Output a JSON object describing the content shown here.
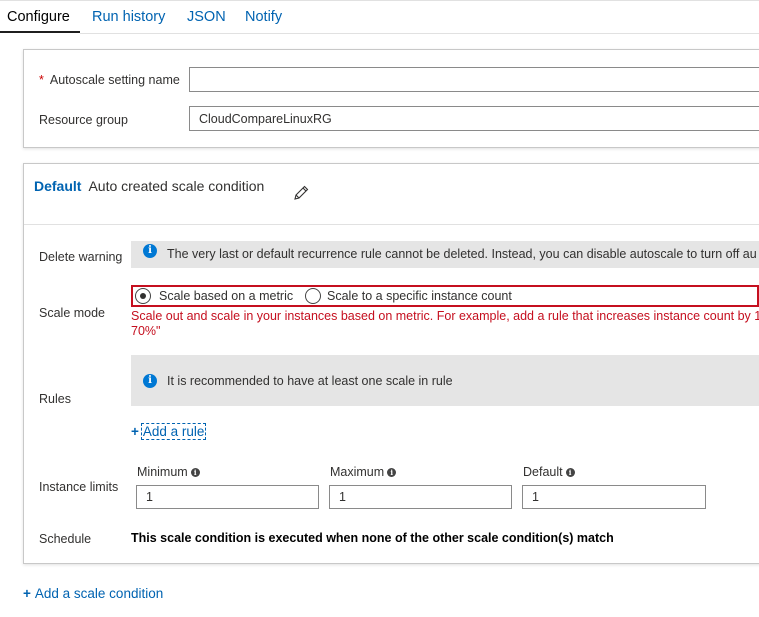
{
  "tabs": [
    {
      "label": "Configure",
      "active": true
    },
    {
      "label": "Run history",
      "active": false
    },
    {
      "label": "JSON",
      "active": false
    },
    {
      "label": "Notify",
      "active": false
    }
  ],
  "settings": {
    "autoscale_name_label": "Autoscale setting name",
    "required_marker": "*",
    "autoscale_name_value": "",
    "resource_group_label": "Resource group",
    "resource_group_value": "CloudCompareLinuxRG"
  },
  "condition": {
    "title_bold": "Default",
    "title_rest": "Auto created scale condition",
    "edit_icon": "pencil-icon",
    "delete_warning_label": "Delete warning",
    "delete_warning_text": "The very last or default recurrence rule cannot be deleted. Instead, you can disable autoscale to turn off au",
    "scale_mode_label": "Scale mode",
    "scale_mode_options": [
      {
        "label": "Scale based on a metric",
        "selected": true
      },
      {
        "label": "Scale to a specific instance count",
        "selected": false
      }
    ],
    "scale_mode_description_line1": "Scale out and scale in your instances based on metric. For example, add a rule that increases instance count by 1",
    "scale_mode_description_line2": "70%\"",
    "rules_label": "Rules",
    "rules_info": "It is recommended to have at least one scale in rule",
    "add_rule": "Add a rule",
    "instance_limits_label": "Instance limits",
    "minimum_label": "Minimum",
    "minimum_value": "1",
    "maximum_label": "Maximum",
    "maximum_value": "1",
    "default_label": "Default",
    "default_value": "1",
    "schedule_label": "Schedule",
    "schedule_text": "This scale condition is executed when none of the other scale condition(s) match"
  },
  "add_scale_condition": "Add a scale condition",
  "colors": {
    "accent": "#0063b1",
    "error": "#c50f1f",
    "info": "#0078d4"
  }
}
